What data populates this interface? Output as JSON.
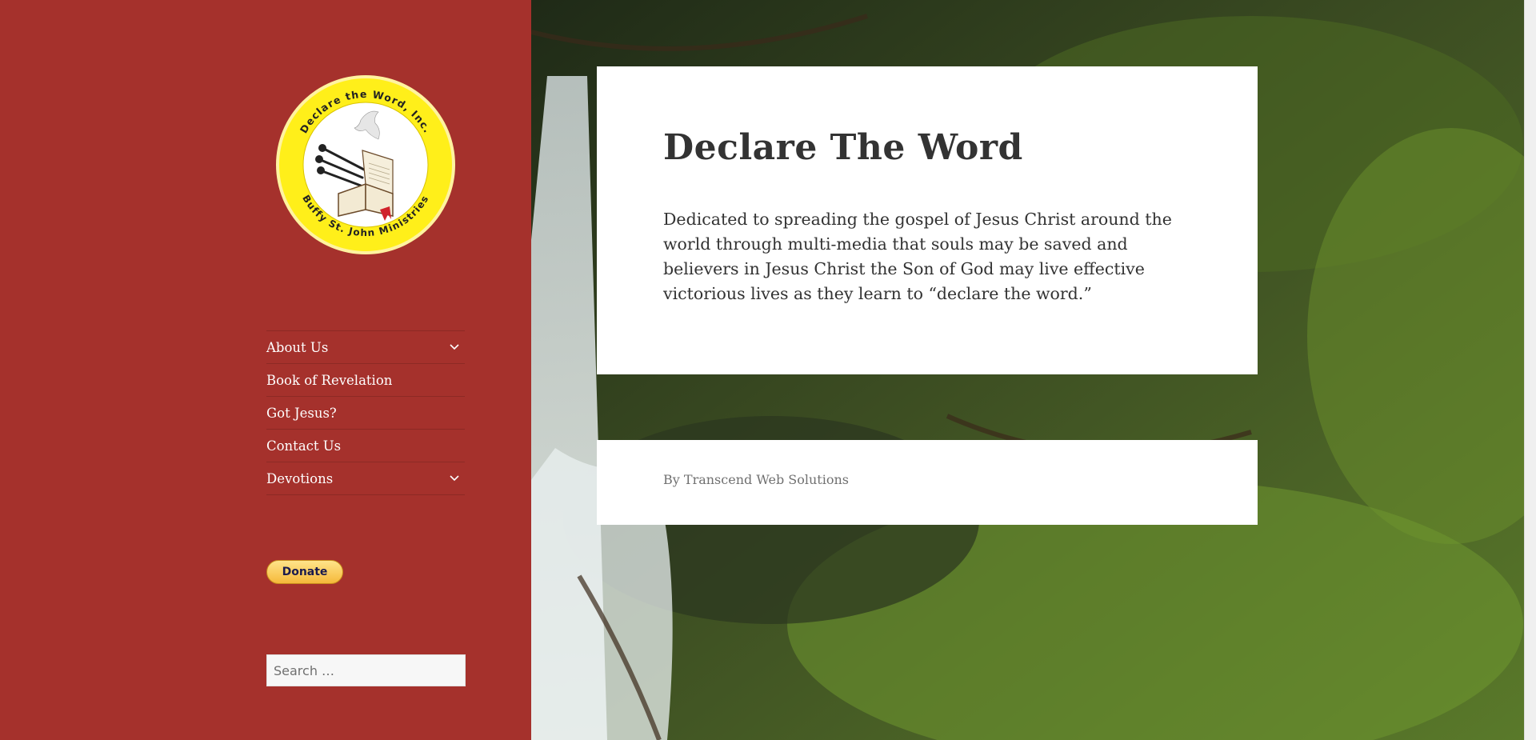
{
  "logo": {
    "ring_top_text": "Declare the Word, Inc.",
    "ring_bottom_text": "Buffy St. John Ministries",
    "colors": {
      "ring": "#ffef1a",
      "center": "#ffffff",
      "book": "#f3ead3"
    }
  },
  "nav": {
    "items": [
      {
        "label": "About Us",
        "has_submenu": true
      },
      {
        "label": "Book of Revelation",
        "has_submenu": false
      },
      {
        "label": "Got Jesus?",
        "has_submenu": false
      },
      {
        "label": "Contact Us",
        "has_submenu": false
      },
      {
        "label": "Devotions",
        "has_submenu": true
      }
    ]
  },
  "donate": {
    "label": "Donate"
  },
  "search": {
    "placeholder": "Search …"
  },
  "main": {
    "title": "Declare The Word",
    "text": "Dedicated to spreading the gospel of Jesus Christ around the world through multi-media that souls may be saved and believers in Jesus Christ the Son of God may live effective victorious lives as they learn to “declare the word.”"
  },
  "footer": {
    "prefix": "By",
    "link": "Transcend Web Solutions"
  },
  "colors": {
    "sidebar": "#a5312c",
    "card": "#ffffff",
    "text": "#333333",
    "muted": "#707070",
    "donate": "#f5b93a"
  }
}
